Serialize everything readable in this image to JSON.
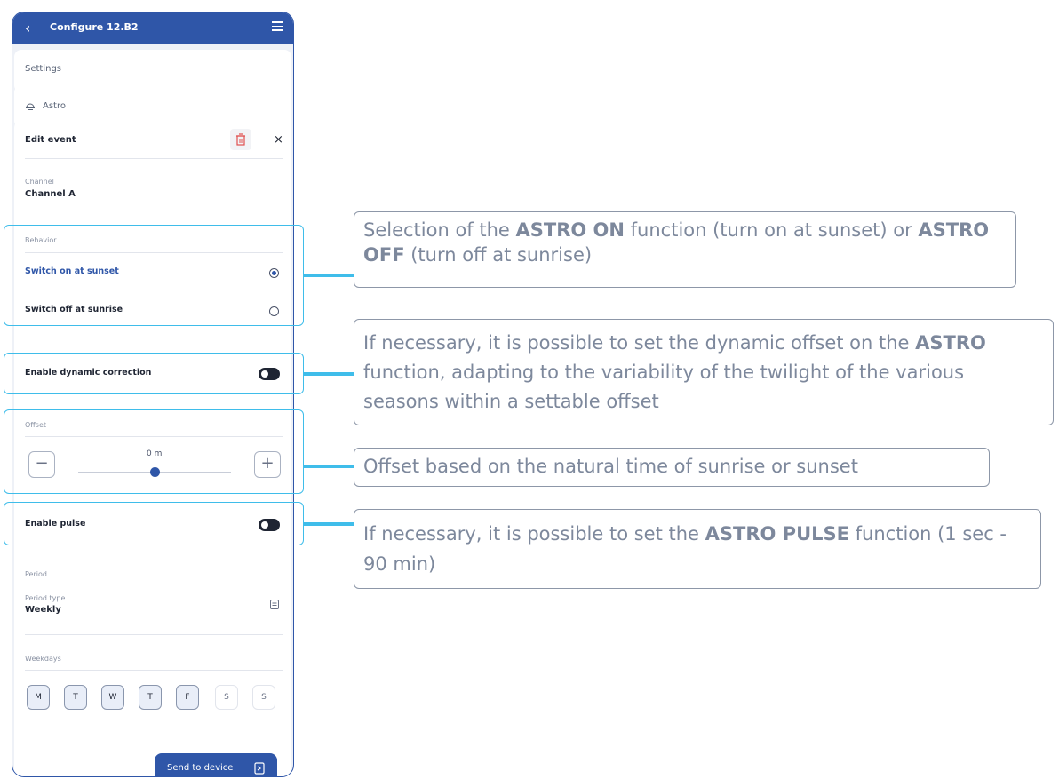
{
  "app": {
    "title": "Configure 12.B2"
  },
  "settings": {
    "label": "Settings"
  },
  "astro": {
    "label": "Astro"
  },
  "edit_event": {
    "title": "Edit event",
    "close": "×"
  },
  "channel": {
    "label": "Channel",
    "value": "Channel A"
  },
  "behavior": {
    "label": "Behavior",
    "options": [
      {
        "label": "Switch on at sunset",
        "selected": true
      },
      {
        "label": "Switch off at sunrise",
        "selected": false
      }
    ]
  },
  "dynamic_correction": {
    "label": "Enable dynamic correction",
    "enabled": false
  },
  "offset": {
    "label": "Offset",
    "value": "0 m",
    "minus": "−",
    "plus": "+"
  },
  "pulse": {
    "label": "Enable pulse",
    "enabled": false
  },
  "period": {
    "label": "Period",
    "type_label": "Period type",
    "type_value": "Weekly",
    "weekdays_label": "Weekdays",
    "days": [
      {
        "label": "M",
        "active": true
      },
      {
        "label": "T",
        "active": true
      },
      {
        "label": "W",
        "active": true
      },
      {
        "label": "T",
        "active": true
      },
      {
        "label": "F",
        "active": true
      },
      {
        "label": "S",
        "active": false
      },
      {
        "label": "S",
        "active": false
      }
    ]
  },
  "send_button": {
    "label": "Send to device"
  },
  "callouts": [
    {
      "pre": "Selection of the ",
      "b1": "ASTRO ON",
      "mid": " function (turn on at sunset) or ",
      "b2": "ASTRO OFF",
      "post": " (turn off at sunrise)"
    },
    {
      "pre": "If necessary, it is possible to set the dynamic offset on the ",
      "b1": "ASTRO",
      "post": " function, adapting to the variability of the twilight of the various seasons within a settable offset"
    },
    {
      "text": "Offset based on the natural time of sunrise or sunset"
    },
    {
      "pre": "If necessary, it is possible to set the ",
      "b1": "ASTRO PULSE",
      "post": " function (1 sec - 90 min)"
    }
  ],
  "colors": {
    "primary": "#2f56a8",
    "highlight": "#3fbdea",
    "callout_text": "#7d889c"
  }
}
